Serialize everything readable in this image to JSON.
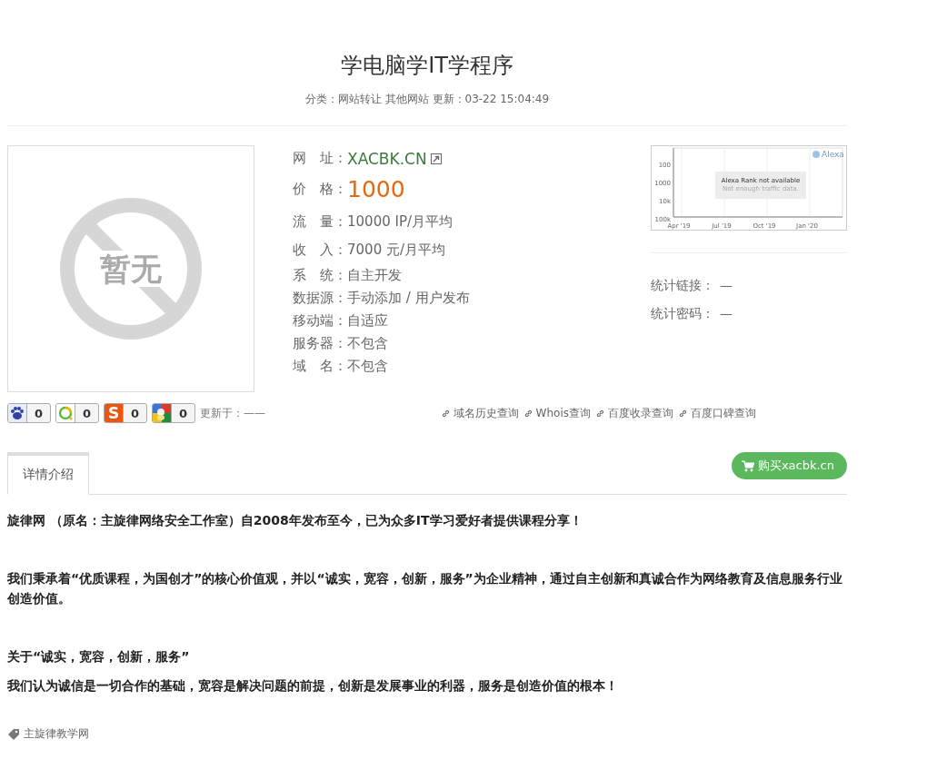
{
  "header": {
    "title": "学电脑学IT学程序",
    "meta": "分类：网站转让 其他网站 更新：03-22 15:04:49"
  },
  "image": {
    "placeholder_text": "暂无"
  },
  "info": [
    {
      "kind": "link",
      "label": "网　址：",
      "value": "XACBK.CN"
    },
    {
      "kind": "price",
      "label": "价　格：",
      "value": "1000"
    },
    {
      "kind": "plain",
      "label": "流　量：",
      "value": "10000 IP/月平均"
    },
    {
      "kind": "plain",
      "label": "收　入：",
      "value": "7000 元/月平均"
    },
    {
      "kind": "plain",
      "label": "系　统：",
      "value": "自主开发"
    },
    {
      "kind": "plain",
      "label": "数据源：",
      "value": "手动添加 / 用户发布"
    },
    {
      "kind": "plain",
      "label": "移动端：",
      "value": "自适应"
    },
    {
      "kind": "plain",
      "label": "服务器：",
      "value": "不包含"
    },
    {
      "kind": "plain",
      "label": "域　名：",
      "value": "不包含"
    }
  ],
  "alexa": {
    "brand": "Alexa",
    "message": "Alexa Rank not available",
    "note": "Not enough traffic data.",
    "y_labels": [
      "100",
      "1000",
      "10k",
      "100k"
    ],
    "x_labels": [
      "Apr '19",
      "Jul '19",
      "Oct '19",
      "Jan '20"
    ]
  },
  "stats": {
    "link_label": "统计链接：",
    "link_value": "—",
    "password_label": "统计密码：",
    "password_value": "—"
  },
  "badges": [
    {
      "kind": "baidu",
      "count": "0"
    },
    {
      "kind": "qihoo",
      "count": "0"
    },
    {
      "kind": "sogou",
      "logo_letter": "S",
      "count": "0"
    },
    {
      "kind": "google",
      "count": "0"
    }
  ],
  "updated": "更新于：——",
  "query_links": [
    "域名历史查询",
    "Whois查询",
    "百度收录查询",
    "百度口碑查询"
  ],
  "tabs": [
    {
      "label": "详情介绍",
      "selected": true
    }
  ],
  "buy_button": "购买xacbk.cn",
  "article": [
    {
      "kind": "para",
      "text": "旋律网 （原名：主旋律网络安全工作室）自2008年发布至今，已为众多IT学习爱好者提供课程分享！"
    },
    {
      "kind": "gap"
    },
    {
      "kind": "para",
      "text": "我们秉承着“优质课程，为国创才”的核心价值观，并以“诚实，宽容，创新，服务”为企业精神，通过自主创新和真诚合作为网络教育及信息服务行业创造价值。"
    },
    {
      "kind": "gap"
    },
    {
      "kind": "para",
      "text": "关于“诚实，宽容，创新，服务”"
    },
    {
      "kind": "para",
      "text": "我们认为诚信是一切合作的基础，宽容是解决问题的前提，创新是发展事业的利器，服务是创造价值的根本！"
    }
  ],
  "tag": "主旋律教学网"
}
